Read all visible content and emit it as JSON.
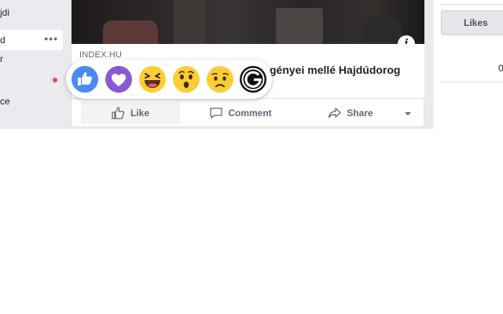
{
  "sidebar": {
    "items": [
      {
        "label": "jdi"
      },
      {
        "label": "d",
        "more": "•••"
      },
      {
        "label": "r"
      },
      {
        "label": "ce"
      }
    ]
  },
  "post": {
    "link_domain": "INDEX.HU",
    "link_title_visible": "gényei mellé Hajdúdorog",
    "info_label": "i",
    "actions": {
      "like": "Like",
      "comment": "Comment",
      "share": "Share"
    }
  },
  "reactions": [
    "like",
    "love",
    "haha",
    "wow",
    "sad",
    "custom-g"
  ],
  "right_panel": {
    "likes_tab": "Likes",
    "partial_number": "0"
  },
  "colors": {
    "facebook_blue": "#4267b2",
    "like_blue": "#4a8af4",
    "love_purple": "#8c59d6",
    "emoji_yellow": "#fccd35",
    "background": "#e9ebee"
  }
}
